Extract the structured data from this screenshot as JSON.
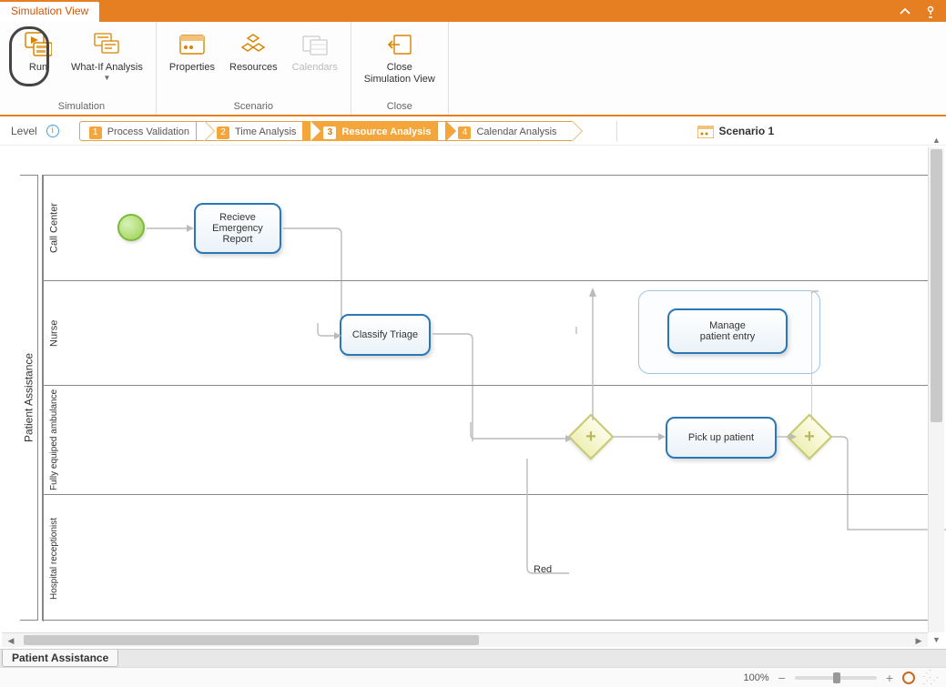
{
  "tab_title": "Simulation View",
  "ribbon": {
    "groups": {
      "simulation": {
        "label": "Simulation",
        "run": "Run",
        "whatif": "What-If Analysis"
      },
      "scenario": {
        "label": "Scenario",
        "properties": "Properties",
        "resources": "Resources",
        "calendars": "Calendars"
      },
      "close": {
        "label": "Close",
        "close_view": "Close\nSimulation View"
      }
    }
  },
  "level_label": "Level",
  "steps": [
    {
      "num": "1",
      "label": "Process Validation"
    },
    {
      "num": "2",
      "label": "Time Analysis"
    },
    {
      "num": "3",
      "label": "Resource Analysis"
    },
    {
      "num": "4",
      "label": "Calendar Analysis"
    }
  ],
  "active_step_index": 2,
  "scenario_name": "Scenario 1",
  "pool_name": "Patient Assistance",
  "lanes": [
    {
      "name": "Call Center"
    },
    {
      "name": "Nurse"
    },
    {
      "name": "Fully equiped ambulance"
    },
    {
      "name": "Hospital receptionist"
    }
  ],
  "tasks": {
    "receive_report": "Recieve\nEmergency\nReport",
    "classify_triage": "Classify Triage",
    "manage_entry": "Manage\npatient entry",
    "pick_up": "Pick up patient"
  },
  "annotations": {
    "red": "Red"
  },
  "bottom_tab": "Patient Assistance",
  "zoom_label": "100%"
}
